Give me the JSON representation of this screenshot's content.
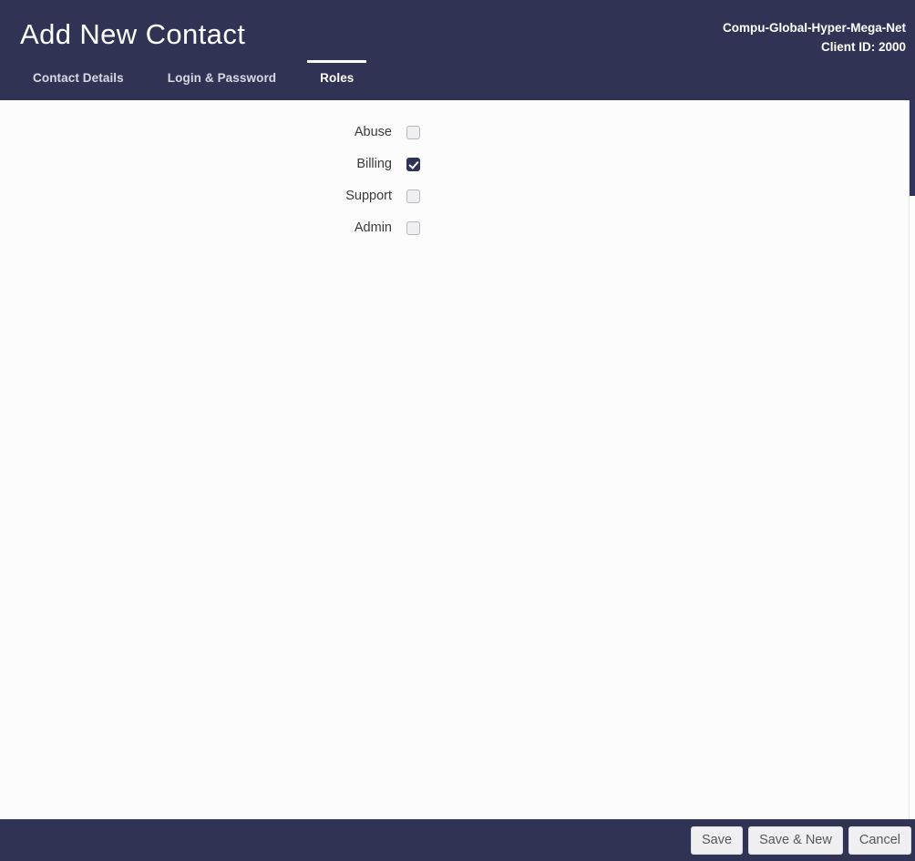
{
  "header": {
    "title": "Add New Contact",
    "client_name": "Compu-Global-Hyper-Mega-Net",
    "client_id": "Client ID: 2000",
    "background_color": "#313355",
    "tabs": [
      {
        "label": "Contact Details",
        "active": false
      },
      {
        "label": "Login & Password",
        "active": false
      },
      {
        "label": "Roles",
        "active": true
      }
    ]
  },
  "main": {
    "roles": [
      {
        "label": "Abuse",
        "checked": false
      },
      {
        "label": "Billing",
        "checked": true
      },
      {
        "label": "Support",
        "checked": false
      },
      {
        "label": "Admin",
        "checked": false
      }
    ]
  },
  "footer": {
    "background_color": "#313355",
    "buttons": [
      {
        "label": "Save",
        "name": "save-button"
      },
      {
        "label": "Save & New",
        "name": "save-and-new-button"
      },
      {
        "label": "Cancel",
        "name": "cancel-button"
      }
    ]
  },
  "scrollbar": {
    "thumb_color": "#32355a"
  }
}
